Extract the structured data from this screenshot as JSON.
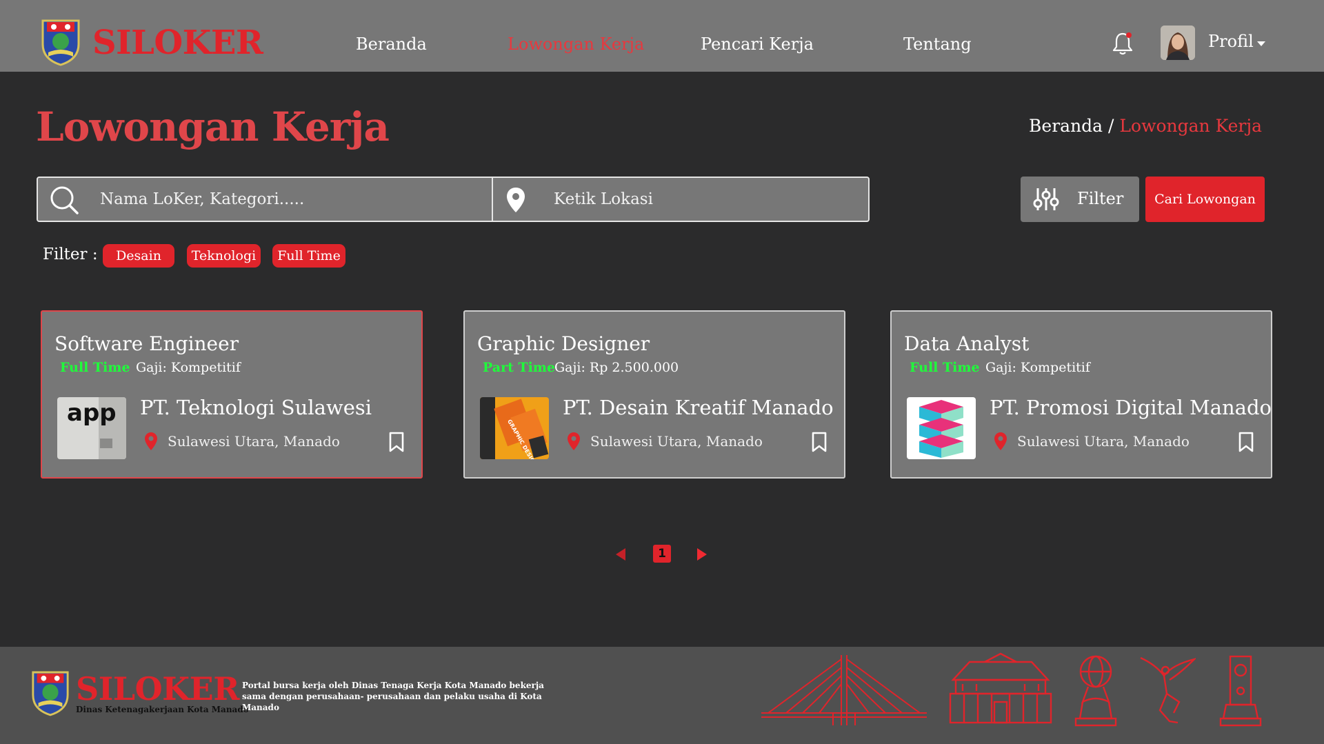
{
  "header": {
    "brand": "SILOKER",
    "nav": [
      "Beranda",
      "Lowongan Kerja",
      "Pencari Kerja",
      "Tentang"
    ],
    "active_nav": "Lowongan Kerja",
    "profile_label": "Profil",
    "icons": {
      "logo": "city-emblem-icon",
      "notification": "bell-icon",
      "dropdown": "caret-down-icon"
    }
  },
  "page": {
    "title": "Lowongan Kerja",
    "breadcrumb": {
      "home": "Beranda",
      "separator": "/",
      "current": "Lowongan Kerja"
    }
  },
  "search": {
    "keyword_placeholder": "Nama LoKer, Kategori.....",
    "location_placeholder": "Ketik Lokasi",
    "filter_label": "Filter",
    "submit_label": "Cari Lowongan"
  },
  "filters": {
    "label": "Filter :",
    "chips": [
      "Desain",
      "Teknologi",
      "Full Time"
    ]
  },
  "jobs": [
    {
      "title": "Software Engineer",
      "type": "Full Time",
      "salary": "Gaji: Kompetitif",
      "company": "PT. Teknologi Sulawesi",
      "location": "Sulawesi Utara, Manado",
      "logo_text": "app"
    },
    {
      "title": "Graphic Designer",
      "type": "Part Time",
      "salary": "Gaji: Rp 2.500.000",
      "company": "PT. Desain Kreatif Manado",
      "location": "Sulawesi Utara, Manado",
      "logo_text": "GRAPHIC DESIGN"
    },
    {
      "title": "Data Analyst",
      "type": "Full Time",
      "salary": "Gaji: Kompetitif",
      "company": "PT. Promosi Digital Manado",
      "location": "Sulawesi Utara, Manado",
      "logo_text": ""
    }
  ],
  "pagination": {
    "current_page": "1"
  },
  "footer": {
    "brand": "SILOKER",
    "subtitle": "Dinas Ketenagakerjaan Kota Manado",
    "description": "Portal bursa kerja oleh Dinas Tenaga Kerja Kota Manado bekerja sama dengan perusahaan- perusahaan dan pelaku usaha di Kota Manado",
    "landmark_icons": [
      "bridge-icon",
      "government-building-icon",
      "globe-monument-icon",
      "angel-statue-icon",
      "tower-monument-icon"
    ]
  },
  "colors": {
    "brand_red": "#e0242b",
    "header_bg": "#777777",
    "page_bg": "#2b2b2c",
    "footer_bg": "#505050",
    "job_type_green": "#1eff3a"
  }
}
